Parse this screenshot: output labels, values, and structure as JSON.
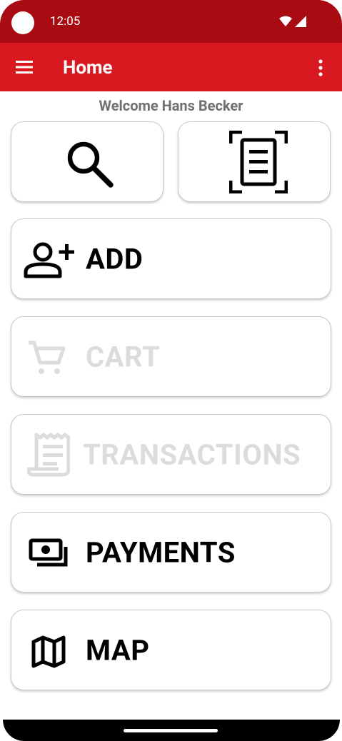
{
  "status": {
    "time": "12:05"
  },
  "appbar": {
    "title": "Home"
  },
  "welcome": "Welcome Hans Becker",
  "actions": {
    "search_icon": "search-icon",
    "scan_icon": "document-scanner-icon"
  },
  "menu": [
    {
      "label": "ADD",
      "icon": "person-add-icon",
      "enabled": true
    },
    {
      "label": "CART",
      "icon": "cart-icon",
      "enabled": false
    },
    {
      "label": "TRANSACTIONS",
      "icon": "receipt-icon",
      "enabled": false
    },
    {
      "label": "PAYMENTS",
      "icon": "payments-icon",
      "enabled": true
    },
    {
      "label": "MAP",
      "icon": "map-icon",
      "enabled": true
    }
  ],
  "colors": {
    "status_bar": "#a80b12",
    "app_bar": "#d81920",
    "enabled_text": "#000000",
    "disabled_text": "#dcdcdc",
    "welcome_text": "#707070"
  }
}
